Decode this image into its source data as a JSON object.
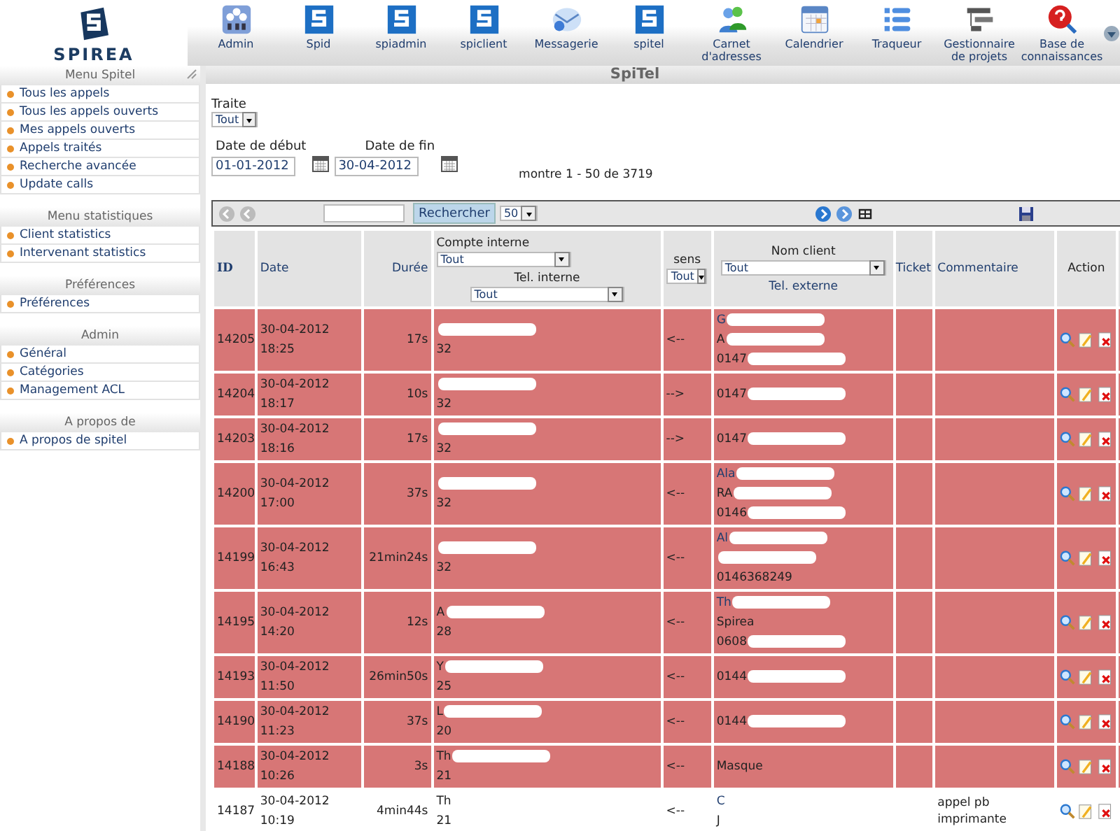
{
  "logo": {
    "text": "SPIREA"
  },
  "apps": [
    {
      "label": "Admin",
      "kind": "admin"
    },
    {
      "label": "Spid",
      "kind": "spirea"
    },
    {
      "label": "spiadmin",
      "kind": "spirea"
    },
    {
      "label": "spiclient",
      "kind": "spirea"
    },
    {
      "label": "Messagerie",
      "kind": "mail"
    },
    {
      "label": "spitel",
      "kind": "spirea"
    },
    {
      "label": "Carnet d'adresses",
      "kind": "contacts"
    },
    {
      "label": "Calendrier",
      "kind": "calendar"
    },
    {
      "label": "Traqueur",
      "kind": "list"
    },
    {
      "label": "Gestionnaire de projets",
      "kind": "gantt"
    },
    {
      "label": "Base de connaissances",
      "kind": "help"
    }
  ],
  "page_title": "SpiTel",
  "sidebar": [
    {
      "title": "Menu Spitel",
      "items": [
        "Tous les appels",
        "Tous les appels ouverts",
        "Mes appels ouverts",
        "Appels traités",
        "Recherche avancée",
        "Update calls"
      ]
    },
    {
      "title": "Menu statistiques",
      "items": [
        "Client statistics",
        "Intervenant statistics"
      ]
    },
    {
      "title": "Préférences",
      "items": [
        "Préférences"
      ]
    },
    {
      "title": "Admin",
      "items": [
        "Général",
        "Catégories",
        "Management ACL"
      ]
    },
    {
      "title": "A propos de",
      "items": [
        "A propos de spitel"
      ]
    }
  ],
  "filters": {
    "traite_label": "Traite",
    "traite_value": "Tout",
    "start_label": "Date de début",
    "start_value": "01-01-2012",
    "end_label": "Date de fin",
    "end_value": "30-04-2012",
    "count": "montre 1 - 50 de 3719"
  },
  "toolbar": {
    "search_button": "Rechercher",
    "page_size": "50"
  },
  "table": {
    "columns": {
      "id": "ID",
      "date": "Date",
      "duration": "Durée",
      "account": "Compte interne",
      "account_filter": "Tout",
      "internal_tel": "Tel. interne",
      "internal_tel_filter": "Tout",
      "direction": "sens",
      "direction_filter": "Tout",
      "client": "Nom client",
      "client_filter": "Tout",
      "external_tel": "Tel. externe",
      "ticket": "Ticket",
      "comment": "Commentaire",
      "action": "Action"
    },
    "rows": [
      {
        "id": "14205",
        "date": "30-04-2012",
        "time": "18:25",
        "duration": "17s",
        "account_redacted": true,
        "internal_tel": "32",
        "direction": "<--",
        "client_lines": [
          {
            "text": "G",
            "kind": "name",
            "redacted": true
          },
          {
            "text": "A",
            "kind": "plain",
            "redacted": true
          },
          {
            "text": "0147",
            "kind": "plain",
            "redacted": true
          }
        ],
        "highlighted": true
      },
      {
        "id": "14204",
        "date": "30-04-2012",
        "time": "18:17",
        "duration": "10s",
        "account_redacted": true,
        "internal_tel": "32",
        "direction": "-->",
        "client_lines": [
          {
            "text": "0147",
            "kind": "plain",
            "redacted": true
          }
        ],
        "highlighted": true
      },
      {
        "id": "14203",
        "date": "30-04-2012",
        "time": "18:16",
        "duration": "17s",
        "account_redacted": true,
        "internal_tel": "32",
        "direction": "-->",
        "client_lines": [
          {
            "text": "0147",
            "kind": "plain",
            "redacted": true
          }
        ],
        "highlighted": true
      },
      {
        "id": "14200",
        "date": "30-04-2012",
        "time": "17:00",
        "duration": "37s",
        "account_redacted": true,
        "internal_tel": "32",
        "direction": "<--",
        "client_lines": [
          {
            "text": "Ala",
            "kind": "name",
            "redacted": true
          },
          {
            "text": "RA",
            "kind": "plain",
            "redacted": true
          },
          {
            "text": "0146",
            "kind": "plain",
            "redacted": true
          }
        ],
        "highlighted": true
      },
      {
        "id": "14199",
        "date": "30-04-2012",
        "time": "16:43",
        "duration": "21min24s",
        "account_redacted": true,
        "internal_tel": "32",
        "direction": "<--",
        "client_lines": [
          {
            "text": "Al",
            "kind": "name",
            "redacted": true
          },
          {
            "kind": "plain",
            "redacted": true
          },
          {
            "text": "0146368249",
            "kind": "plain",
            "redacted": false
          }
        ],
        "highlighted": true
      },
      {
        "id": "14195",
        "date": "30-04-2012",
        "time": "14:20",
        "duration": "12s",
        "account": "A",
        "account_redacted": true,
        "internal_tel": "28",
        "direction": "<--",
        "client_lines": [
          {
            "text": "Th",
            "kind": "name",
            "redacted": true
          },
          {
            "text": "Spirea",
            "kind": "plain",
            "redacted": false
          },
          {
            "text": "0608",
            "kind": "plain",
            "redacted": true
          }
        ],
        "highlighted": true
      },
      {
        "id": "14193",
        "date": "30-04-2012",
        "time": "11:50",
        "duration": "26min50s",
        "account": "Y",
        "account_redacted": true,
        "internal_tel": "25",
        "direction": "<--",
        "client_lines": [
          {
            "text": "0144",
            "kind": "plain",
            "redacted": true
          }
        ],
        "highlighted": true
      },
      {
        "id": "14190",
        "date": "30-04-2012",
        "time": "11:23",
        "duration": "37s",
        "account": "L",
        "account_redacted": true,
        "internal_tel": "20",
        "direction": "<--",
        "client_lines": [
          {
            "text": "0144",
            "kind": "plain",
            "redacted": true
          }
        ],
        "highlighted": true
      },
      {
        "id": "14188",
        "date": "30-04-2012",
        "time": "10:26",
        "duration": "3s",
        "account": "Th",
        "account_redacted": true,
        "internal_tel": "21",
        "direction": "<--",
        "client_lines": [
          {
            "text": "Masque",
            "kind": "plain",
            "redacted": false
          }
        ],
        "highlighted": true
      },
      {
        "id": "14187",
        "date": "30-04-2012",
        "time": "10:19",
        "duration": "4min44s",
        "account": "Th",
        "internal_tel": "21",
        "direction": "<--",
        "client_lines": [
          {
            "text": "C",
            "kind": "name"
          },
          {
            "text": "J",
            "kind": "plain"
          }
        ],
        "comment": "appel pb imprimante",
        "highlighted": false
      }
    ]
  }
}
